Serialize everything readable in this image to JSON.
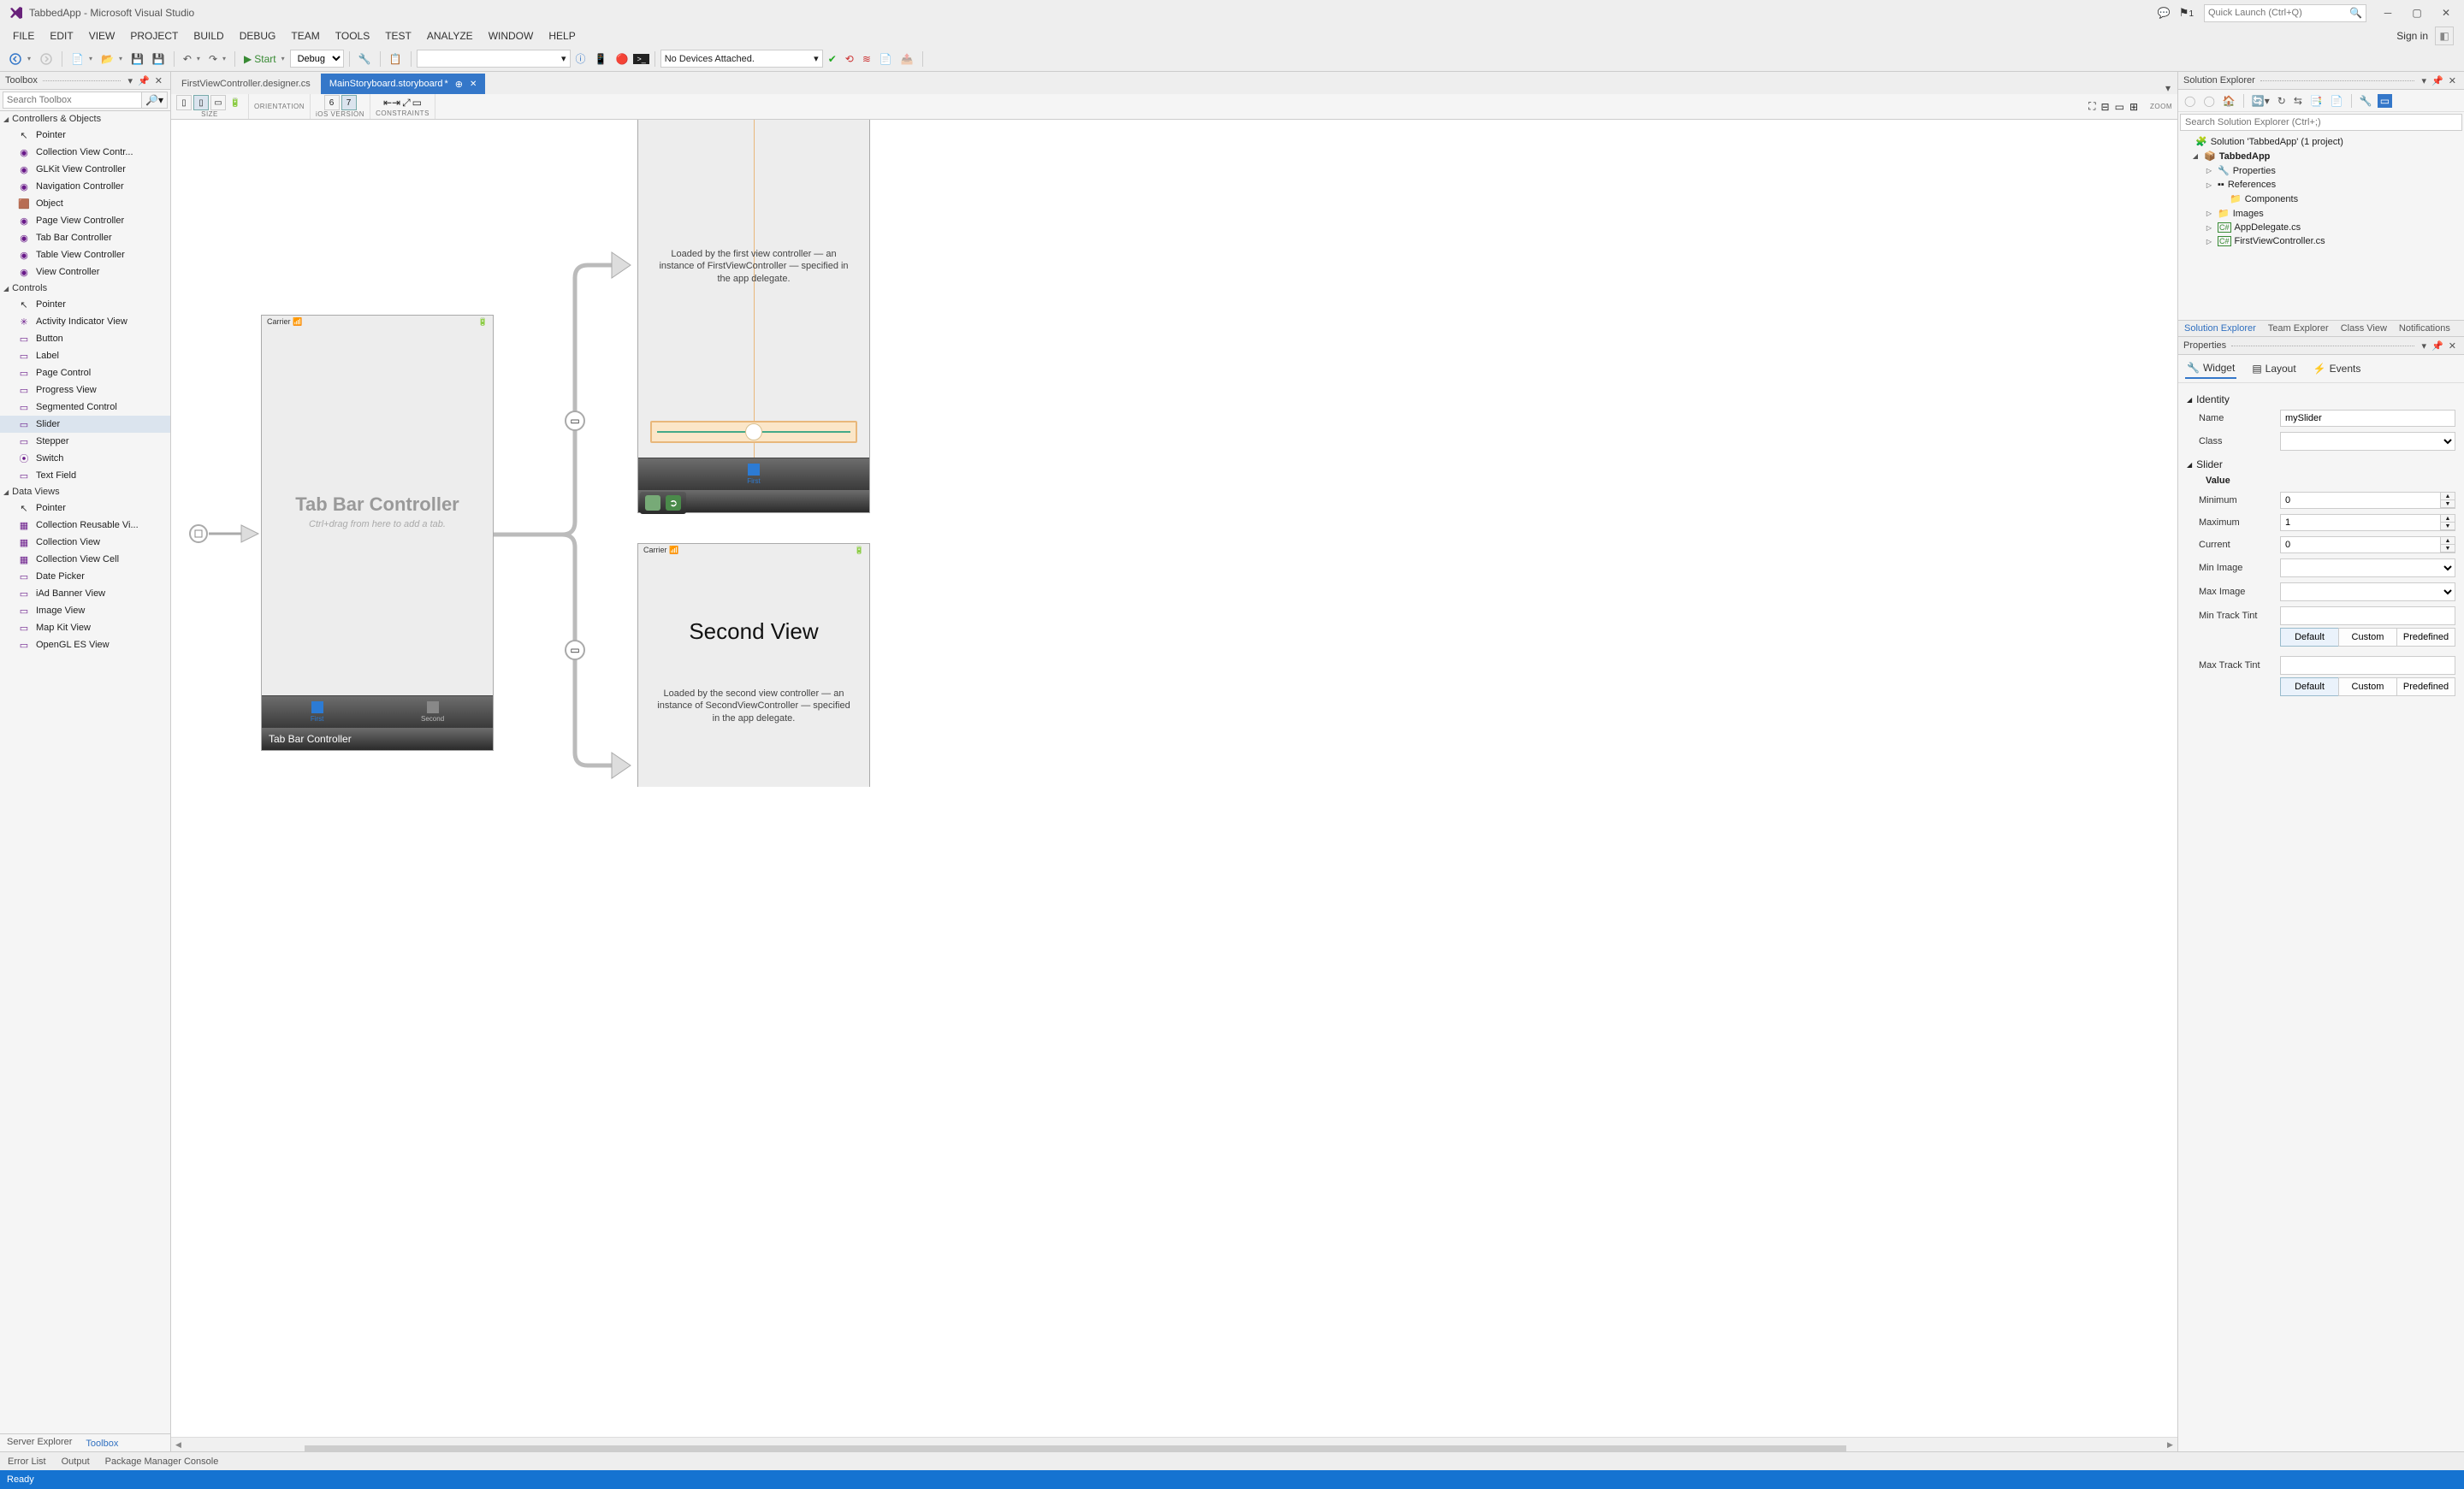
{
  "title": "TabbedApp - Microsoft Visual Studio",
  "menu": [
    "FILE",
    "EDIT",
    "VIEW",
    "PROJECT",
    "BUILD",
    "DEBUG",
    "TEAM",
    "TOOLS",
    "TEST",
    "ANALYZE",
    "WINDOW",
    "HELP"
  ],
  "signin": "Sign in",
  "quickLaunch": {
    "placeholder": "Quick Launch (Ctrl+Q)"
  },
  "notifCount": "1",
  "toolbar": {
    "start": "Start",
    "config": "Debug",
    "devices": "No Devices Attached."
  },
  "toolbox": {
    "title": "Toolbox",
    "searchPlaceholder": "Search Toolbox",
    "groups": [
      {
        "name": "Controllers & Objects",
        "items": [
          {
            "label": "Pointer",
            "icon": "cursor"
          },
          {
            "label": "Collection View Contr...",
            "icon": "circ"
          },
          {
            "label": "GLKit View Controller",
            "icon": "circ"
          },
          {
            "label": "Navigation Controller",
            "icon": "circ"
          },
          {
            "label": "Object",
            "icon": "cube"
          },
          {
            "label": "Page View Controller",
            "icon": "circ"
          },
          {
            "label": "Tab Bar Controller",
            "icon": "circ"
          },
          {
            "label": "Table View Controller",
            "icon": "circ"
          },
          {
            "label": "View Controller",
            "icon": "circ"
          }
        ]
      },
      {
        "name": "Controls",
        "items": [
          {
            "label": "Pointer",
            "icon": "cursor"
          },
          {
            "label": "Activity Indicator View",
            "icon": "spin"
          },
          {
            "label": "Button",
            "icon": "rect"
          },
          {
            "label": "Label",
            "icon": "rect"
          },
          {
            "label": "Page Control",
            "icon": "rect"
          },
          {
            "label": "Progress View",
            "icon": "rect"
          },
          {
            "label": "Segmented Control",
            "icon": "rect"
          },
          {
            "label": "Slider",
            "icon": "rect",
            "sel": true
          },
          {
            "label": "Stepper",
            "icon": "rect"
          },
          {
            "label": "Switch",
            "icon": "switch"
          },
          {
            "label": "Text Field",
            "icon": "rect"
          }
        ]
      },
      {
        "name": "Data Views",
        "items": [
          {
            "label": "Pointer",
            "icon": "cursor"
          },
          {
            "label": "Collection Reusable Vi...",
            "icon": "grid"
          },
          {
            "label": "Collection View",
            "icon": "grid"
          },
          {
            "label": "Collection View Cell",
            "icon": "grid"
          },
          {
            "label": "Date Picker",
            "icon": "rect"
          },
          {
            "label": "iAd Banner View",
            "icon": "rect"
          },
          {
            "label": "Image View",
            "icon": "rect"
          },
          {
            "label": "Map Kit View",
            "icon": "rect"
          },
          {
            "label": "OpenGL ES View",
            "icon": "rect"
          }
        ]
      }
    ],
    "tabs": [
      "Server Explorer",
      "Toolbox"
    ],
    "activeTab": 1
  },
  "documents": {
    "tabs": [
      {
        "label": "FirstViewController.designer.cs",
        "active": false
      },
      {
        "label": "MainStoryboard.storyboard",
        "active": true,
        "dirty": true
      }
    ]
  },
  "canvasBar": {
    "size": "SIZE",
    "orientation": "ORIENTATION",
    "iosVersion": "iOS VERSION",
    "constraints": "CONSTRAINTS",
    "v6": "6",
    "v7": "7",
    "zoom": "ZOOM"
  },
  "storyboard": {
    "carrier": "Carrier",
    "tabBarTitle": "Tab Bar Controller",
    "tabBarSub": "Ctrl+drag from here to add a tab.",
    "tabBarFooter": "Tab Bar Controller",
    "tabItems": [
      "First",
      "Second"
    ],
    "firstDesc": "Loaded by the first view controller — an instance of FirstViewController — specified in the app delegate.",
    "firstLabel": "First",
    "secondTitle": "Second View",
    "secondDesc": "Loaded by the second view controller — an instance of SecondViewController — specified in the app delegate."
  },
  "solution": {
    "title": "Solution Explorer",
    "searchPlaceholder": "Search Solution Explorer (Ctrl+;)",
    "root": "Solution 'TabbedApp' (1 project)",
    "project": "TabbedApp",
    "children": [
      "Properties",
      "References",
      "Components",
      "Images",
      "AppDelegate.cs",
      "FirstViewController.cs"
    ],
    "tabs": [
      "Solution Explorer",
      "Team Explorer",
      "Class View",
      "Notifications"
    ]
  },
  "properties": {
    "title": "Properties",
    "tabs": [
      "Widget",
      "Layout",
      "Events"
    ],
    "identity": {
      "header": "Identity",
      "nameLabel": "Name",
      "nameValue": "mySlider",
      "classLabel": "Class",
      "classValue": ""
    },
    "slider": {
      "header": "Slider",
      "valueHeader": "Value",
      "minLabel": "Minimum",
      "minValue": "0",
      "maxLabel": "Maximum",
      "maxValue": "1",
      "curLabel": "Current",
      "curValue": "0",
      "minImgLabel": "Min Image",
      "maxImgLabel": "Max Image",
      "minTrackLabel": "Min Track Tint",
      "maxTrackLabel": "Max Track Tint",
      "segDefault": "Default",
      "segCustom": "Custom",
      "segPredef": "Predefined"
    }
  },
  "bottomTabs": [
    "Error List",
    "Output",
    "Package Manager Console"
  ],
  "status": "Ready"
}
